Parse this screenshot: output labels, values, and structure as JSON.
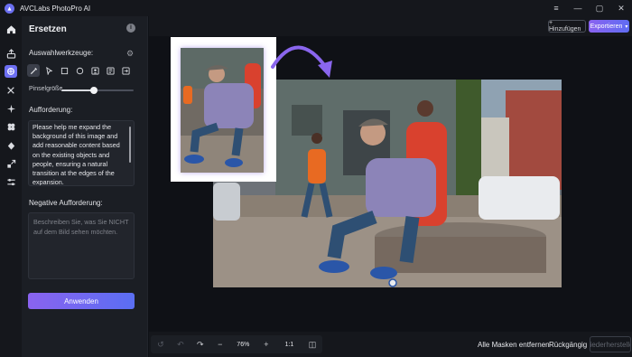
{
  "app": {
    "title": "AVCLabs PhotoPro AI"
  },
  "panel": {
    "title": "Ersetzen",
    "selection_tools_label": "Auswahlwerkzeuge:",
    "brush_size_label": "Pinselgröße",
    "brush_size_value": 0.45,
    "prompt_label": "Aufforderung:",
    "prompt_value": "Please help me expand the background of this image and add reasonable content based on the existing objects and people, ensuring a natural transition at the edges of the expansion.",
    "negative_label": "Negative Aufforderung:",
    "negative_placeholder": "Beschreiben Sie, was Sie NICHT auf dem Bild sehen möchten.",
    "apply_label": "Anwenden"
  },
  "topbar": {
    "add_label": "+ Hinzufügen",
    "export_label": "Exportieren"
  },
  "bottombar": {
    "zoom_value": "76%",
    "ratio_label": "1:1",
    "remove_all_label": "Alle Masken entfernen",
    "undo_label": "Rückgängig",
    "redo_label": "Wiederherstellen"
  },
  "colors": {
    "accent": "#6d6ff2",
    "gradient_start": "#8a63f0",
    "gradient_end": "#5a6ef2"
  }
}
